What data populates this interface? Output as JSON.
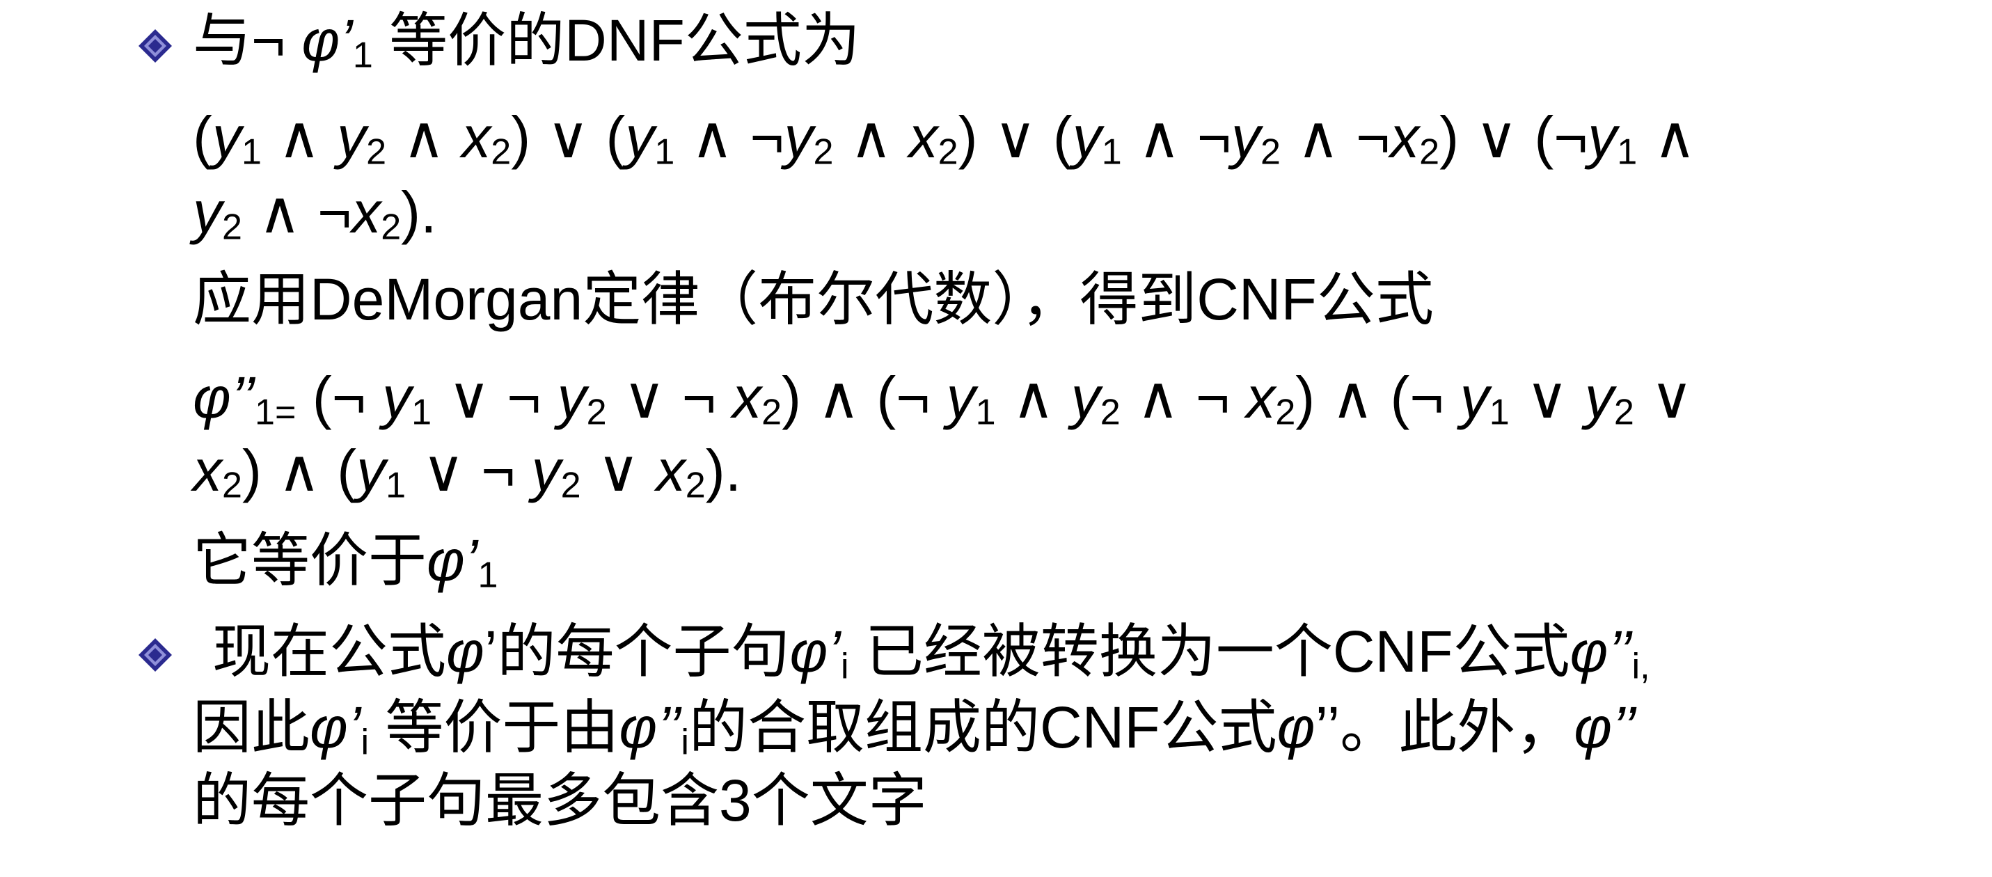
{
  "bullet1": {
    "lead": "与¬ ",
    "phi": "φ",
    "prime": "’",
    "sub": "1",
    "tail": " 等价的DNF公式为"
  },
  "dnf": {
    "line1": [
      "(",
      "y",
      "1",
      " ∧ ",
      "y",
      "2",
      " ∧ ",
      "x",
      "2",
      ") ∨ (",
      "y",
      "1",
      " ∧ ¬",
      "y",
      "2",
      " ∧ ",
      "x",
      "2",
      ") ∨ (",
      "y",
      "1",
      " ∧ ¬",
      "y",
      "2",
      " ∧ ¬",
      "x",
      "2",
      ") ∨ (¬",
      "y",
      "1",
      " ∧"
    ],
    "line2": [
      "y",
      "2",
      " ∧ ¬",
      "x",
      "2",
      ")."
    ]
  },
  "demorgan_text": "应用DeMorgan定律（布尔代数），得到CNF公式",
  "cnf": {
    "line1": [
      "φ",
      "’’",
      "1=",
      " (¬ ",
      "y",
      "1",
      " ∨ ¬ ",
      "y",
      "2",
      " ∨ ¬ ",
      "x",
      "2",
      ") ∧ (¬ ",
      "y",
      "1",
      " ∧ ",
      "y",
      "2",
      " ∧ ¬ ",
      "x",
      "2",
      ") ∧ (¬ ",
      "y",
      "1",
      " ∨ ",
      "y",
      "2",
      " ∨"
    ],
    "line2": [
      "x",
      "2",
      ") ∧ (",
      "y",
      "1",
      " ∨ ¬ ",
      "y",
      "2",
      " ∨ ",
      "x",
      "2",
      ")."
    ]
  },
  "equiv_text": {
    "lead": "它等价于",
    "phi": "φ",
    "prime": "’",
    "sub": "1"
  },
  "bullet2": {
    "line1": [
      "现在公式",
      "φ",
      "’的每个子句",
      "φ",
      "’",
      "i",
      " 已经被转换为一个CNF公式",
      "φ",
      "’’",
      "i,"
    ],
    "line2": [
      "因此",
      "φ",
      "’",
      "i",
      " 等价于由",
      "φ",
      "’’",
      "i",
      "的合取组成的CNF公式",
      "φ",
      "’’。此外，",
      "φ",
      "’’"
    ],
    "line3": "的每个子句最多包含3个文字"
  },
  "colors": {
    "bullet_fill": "#2b2a8f",
    "bullet_highlight": "#8f8fd9",
    "text": "#000000"
  },
  "icons": {
    "bullet": "diamond-bullet-icon"
  }
}
